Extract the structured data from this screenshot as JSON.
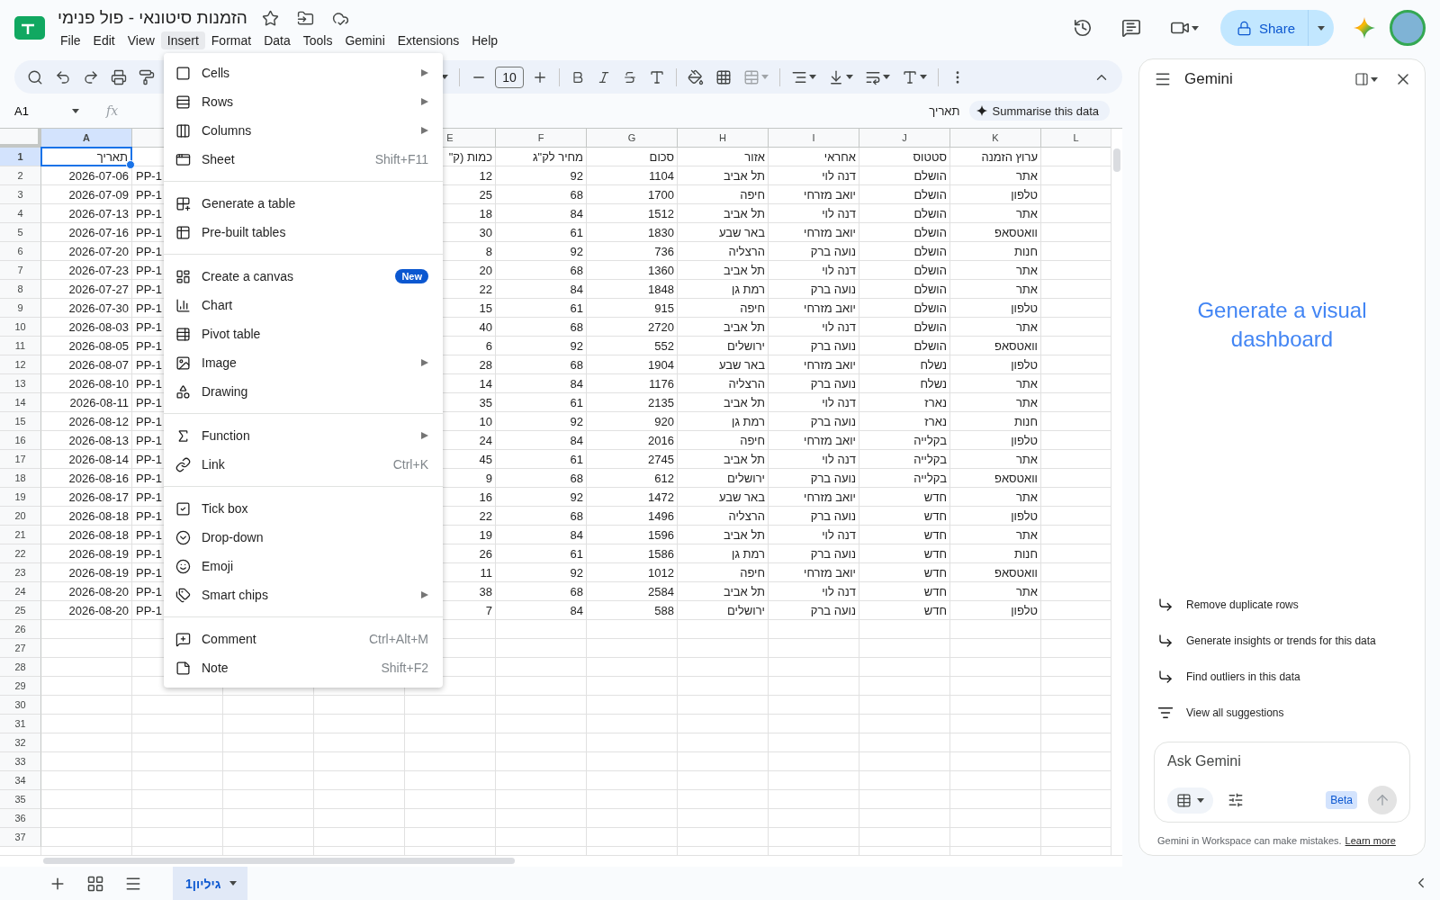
{
  "document": {
    "title": "הזמנות סיטונאי - פול פנימי"
  },
  "menu_bar": {
    "file": {
      "label": "File",
      "selected": false
    },
    "edit": {
      "label": "Edit",
      "selected": false
    },
    "view": {
      "label": "View",
      "selected": false
    },
    "insert": {
      "label": "Insert",
      "selected": true
    },
    "format": {
      "label": "Format",
      "selected": false
    },
    "data": {
      "label": "Data",
      "selected": false
    },
    "tools": {
      "label": "Tools",
      "selected": false
    },
    "gemini": {
      "label": "Gemini",
      "selected": false
    },
    "extensions": {
      "label": "Extensions",
      "selected": false
    },
    "help": {
      "label": "Help",
      "selected": false
    }
  },
  "share": {
    "label": "Share"
  },
  "toolbar": {
    "font_size": "10"
  },
  "formula_bar": {
    "name_box": "A1",
    "fx": "fx",
    "content": "תאריך",
    "chip": "Summarise this data"
  },
  "insert_menu": [
    [
      {
        "label": "Cells",
        "submenu": true
      },
      {
        "label": "Rows",
        "submenu": true
      },
      {
        "label": "Columns",
        "submenu": true
      },
      {
        "label": "Sheet",
        "submenu": false,
        "shortcut": "Shift+F11"
      }
    ],
    [
      {
        "label": "Generate a table",
        "submenu": false
      },
      {
        "label": "Pre-built tables",
        "submenu": false
      }
    ],
    [
      {
        "label": "Create a canvas",
        "submenu": false,
        "badge": "New"
      },
      {
        "label": "Chart",
        "submenu": false
      },
      {
        "label": "Pivot table",
        "submenu": false
      },
      {
        "label": "Image",
        "submenu": true
      },
      {
        "label": "Drawing",
        "submenu": false
      }
    ],
    [
      {
        "label": "Function",
        "submenu": true
      },
      {
        "label": "Link",
        "submenu": false,
        "shortcut": "Ctrl+K"
      }
    ],
    [
      {
        "label": "Tick box",
        "submenu": false
      },
      {
        "label": "Drop-down",
        "submenu": false
      },
      {
        "label": "Emoji",
        "submenu": false
      },
      {
        "label": "Smart chips",
        "submenu": true
      }
    ],
    [
      {
        "label": "Comment",
        "submenu": false,
        "shortcut": "Ctrl+Alt+M"
      },
      {
        "label": "Note",
        "submenu": false,
        "shortcut": "Shift+F2"
      }
    ]
  ],
  "sheet": {
    "columns": {
      "A": {
        "letter": "A",
        "selected": true
      },
      "E": {
        "letter": "E",
        "selected": false
      },
      "F": {
        "letter": "F",
        "selected": false
      },
      "G": {
        "letter": "G",
        "selected": false
      },
      "H": {
        "letter": "H",
        "selected": false
      },
      "I": {
        "letter": "I",
        "selected": false
      },
      "J": {
        "letter": "J",
        "selected": false
      },
      "K": {
        "letter": "K",
        "selected": false
      },
      "L": {
        "letter": "L",
        "selected": false
      }
    },
    "rows": [
      {
        "number": "1",
        "selected": true,
        "cells": {
          "A": "תאריך",
          "E": "כמות (ק\"",
          "F": "מחיר לק\"ג",
          "G": "סכום",
          "H": "אזור",
          "I": "אחראי",
          "J": "סטטוס",
          "K": "ערוץ הזמנה"
        }
      },
      {
        "number": "2",
        "selected": false,
        "cells": {
          "A": "2026-07-06",
          "B": "PP-1",
          "E": "12",
          "F": "92",
          "G": "1104",
          "H": "תל אביב",
          "I": "דנה לוי",
          "J": "הושלם",
          "K": "אתר"
        }
      },
      {
        "number": "3",
        "selected": false,
        "cells": {
          "A": "2026-07-09",
          "B": "PP-1",
          "E": "25",
          "F": "68",
          "G": "1700",
          "H": "חיפה",
          "I": "יואב מזרחי",
          "J": "הושלם",
          "K": "טלפון"
        }
      },
      {
        "number": "4",
        "selected": false,
        "cells": {
          "A": "2026-07-13",
          "B": "PP-1",
          "E": "18",
          "F": "84",
          "G": "1512",
          "H": "תל אביב",
          "I": "דנה לוי",
          "J": "הושלם",
          "K": "אתר"
        }
      },
      {
        "number": "5",
        "selected": false,
        "cells": {
          "A": "2026-07-16",
          "B": "PP-1",
          "E": "30",
          "F": "61",
          "G": "1830",
          "H": "באר שבע",
          "I": "יואב מזרחי",
          "J": "הושלם",
          "K": "וואטסאפ"
        }
      },
      {
        "number": "6",
        "selected": false,
        "cells": {
          "A": "2026-07-20",
          "B": "PP-1",
          "E": "8",
          "F": "92",
          "G": "736",
          "H": "הרצליה",
          "I": "נועה ברק",
          "J": "הושלם",
          "K": "חנות"
        }
      },
      {
        "number": "7",
        "selected": false,
        "cells": {
          "A": "2026-07-23",
          "B": "PP-1",
          "E": "20",
          "F": "68",
          "G": "1360",
          "H": "תל אביב",
          "I": "דנה לוי",
          "J": "הושלם",
          "K": "אתר"
        }
      },
      {
        "number": "8",
        "selected": false,
        "cells": {
          "A": "2026-07-27",
          "B": "PP-1",
          "E": "22",
          "F": "84",
          "G": "1848",
          "H": "רמת גן",
          "I": "נועה ברק",
          "J": "הושלם",
          "K": "אתר"
        }
      },
      {
        "number": "9",
        "selected": false,
        "cells": {
          "A": "2026-07-30",
          "B": "PP-1",
          "E": "15",
          "F": "61",
          "G": "915",
          "H": "חיפה",
          "I": "יואב מזרחי",
          "J": "הושלם",
          "K": "טלפון"
        }
      },
      {
        "number": "10",
        "selected": false,
        "cells": {
          "A": "2026-08-03",
          "B": "PP-1",
          "E": "40",
          "F": "68",
          "G": "2720",
          "H": "תל אביב",
          "I": "דנה לוי",
          "J": "הושלם",
          "K": "אתר"
        }
      },
      {
        "number": "11",
        "selected": false,
        "cells": {
          "A": "2026-08-05",
          "B": "PP-1",
          "E": "6",
          "F": "92",
          "G": "552",
          "H": "ירושלים",
          "I": "נועה ברק",
          "J": "הושלם",
          "K": "וואטסאפ"
        }
      },
      {
        "number": "12",
        "selected": false,
        "cells": {
          "A": "2026-08-07",
          "B": "PP-1",
          "E": "28",
          "F": "68",
          "G": "1904",
          "H": "באר שבע",
          "I": "יואב מזרחי",
          "J": "נשלח",
          "K": "טלפון"
        }
      },
      {
        "number": "13",
        "selected": false,
        "cells": {
          "A": "2026-08-10",
          "B": "PP-1",
          "E": "14",
          "F": "84",
          "G": "1176",
          "H": "הרצליה",
          "I": "נועה ברק",
          "J": "נשלח",
          "K": "אתר"
        }
      },
      {
        "number": "14",
        "selected": false,
        "cells": {
          "A": "2026-08-11",
          "B": "PP-1",
          "E": "35",
          "F": "61",
          "G": "2135",
          "H": "תל אביב",
          "I": "דנה לוי",
          "J": "נארז",
          "K": "אתר"
        }
      },
      {
        "number": "15",
        "selected": false,
        "cells": {
          "A": "2026-08-12",
          "B": "PP-1",
          "E": "10",
          "F": "92",
          "G": "920",
          "H": "רמת גן",
          "I": "נועה ברק",
          "J": "נארז",
          "K": "חנות"
        }
      },
      {
        "number": "16",
        "selected": false,
        "cells": {
          "A": "2026-08-13",
          "B": "PP-1",
          "E": "24",
          "F": "84",
          "G": "2016",
          "H": "חיפה",
          "I": "יואב מזרחי",
          "J": "בקלייה",
          "K": "טלפון"
        }
      },
      {
        "number": "17",
        "selected": false,
        "cells": {
          "A": "2026-08-14",
          "B": "PP-1",
          "E": "45",
          "F": "61",
          "G": "2745",
          "H": "תל אביב",
          "I": "דנה לוי",
          "J": "בקלייה",
          "K": "אתר"
        }
      },
      {
        "number": "18",
        "selected": false,
        "cells": {
          "A": "2026-08-16",
          "B": "PP-1",
          "E": "9",
          "F": "68",
          "G": "612",
          "H": "ירושלים",
          "I": "נועה ברק",
          "J": "בקלייה",
          "K": "וואטסאפ"
        }
      },
      {
        "number": "19",
        "selected": false,
        "cells": {
          "A": "2026-08-17",
          "B": "PP-1",
          "E": "16",
          "F": "92",
          "G": "1472",
          "H": "באר שבע",
          "I": "יואב מזרחי",
          "J": "חדש",
          "K": "אתר"
        }
      },
      {
        "number": "20",
        "selected": false,
        "cells": {
          "A": "2026-08-18",
          "B": "PP-1",
          "E": "22",
          "F": "68",
          "G": "1496",
          "H": "הרצליה",
          "I": "נועה ברק",
          "J": "חדש",
          "K": "טלפון"
        }
      },
      {
        "number": "21",
        "selected": false,
        "cells": {
          "A": "2026-08-18",
          "B": "PP-1",
          "E": "19",
          "F": "84",
          "G": "1596",
          "H": "תל אביב",
          "I": "דנה לוי",
          "J": "חדש",
          "K": "אתר"
        }
      },
      {
        "number": "22",
        "selected": false,
        "cells": {
          "A": "2026-08-19",
          "B": "PP-1",
          "E": "26",
          "F": "61",
          "G": "1586",
          "H": "רמת גן",
          "I": "נועה ברק",
          "J": "חדש",
          "K": "חנות"
        }
      },
      {
        "number": "23",
        "selected": false,
        "cells": {
          "A": "2026-08-19",
          "B": "PP-1",
          "E": "11",
          "F": "92",
          "G": "1012",
          "H": "חיפה",
          "I": "יואב מזרחי",
          "J": "חדש",
          "K": "וואטסאפ"
        }
      },
      {
        "number": "24",
        "selected": false,
        "cells": {
          "A": "2026-08-20",
          "B": "PP-1",
          "E": "38",
          "F": "68",
          "G": "2584",
          "H": "תל אביב",
          "I": "דנה לוי",
          "J": "חדש",
          "K": "אתר"
        }
      },
      {
        "number": "25",
        "selected": false,
        "cells": {
          "A": "2026-08-20",
          "B": "PP-1",
          "E": "7",
          "F": "84",
          "G": "588",
          "H": "ירושלים",
          "I": "נועה ברק",
          "J": "חדש",
          "K": "טלפון"
        }
      },
      {
        "number": "26",
        "selected": false,
        "cells": {}
      },
      {
        "number": "27",
        "selected": false,
        "cells": {}
      },
      {
        "number": "28",
        "selected": false,
        "cells": {}
      },
      {
        "number": "29",
        "selected": false,
        "cells": {}
      },
      {
        "number": "30",
        "selected": false,
        "cells": {}
      },
      {
        "number": "31",
        "selected": false,
        "cells": {}
      },
      {
        "number": "32",
        "selected": false,
        "cells": {}
      },
      {
        "number": "33",
        "selected": false,
        "cells": {}
      },
      {
        "number": "34",
        "selected": false,
        "cells": {}
      },
      {
        "number": "35",
        "selected": false,
        "cells": {}
      },
      {
        "number": "36",
        "selected": false,
        "cells": {}
      },
      {
        "number": "37",
        "selected": false,
        "cells": {}
      }
    ]
  },
  "sheet_tabs": [
    {
      "label": "גיליון1",
      "selected": true
    }
  ],
  "gemini": {
    "title": "Gemini",
    "headline": "Generate a visual dashboard",
    "suggestions": [
      {
        "kind": "prompt",
        "label": "Remove duplicate rows"
      },
      {
        "kind": "prompt",
        "label": "Generate insights or trends for this data"
      },
      {
        "kind": "prompt",
        "label": "Find outliers in this data"
      },
      {
        "kind": "all",
        "label": "View all suggestions"
      }
    ],
    "input": {
      "placeholder": "Ask Gemini"
    },
    "badge": "Beta",
    "disclaimer": "Gemini in Workspace can make mistakes.",
    "link": "Learn more"
  }
}
